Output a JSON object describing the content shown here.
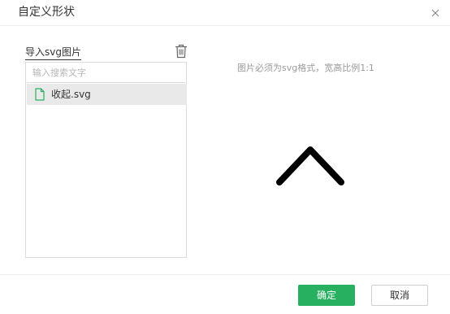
{
  "dialog": {
    "title": "自定义形状"
  },
  "left_panel": {
    "import_label": "导入svg图片",
    "search_placeholder": "输入搜索文字",
    "items": [
      {
        "label": "收起.svg",
        "selected": true
      }
    ]
  },
  "preview": {
    "hint": "图片必须为svg格式，宽高比例1:1",
    "shape_icon": "chevron-up-icon"
  },
  "footer": {
    "ok_label": "确定",
    "cancel_label": "取消"
  },
  "colors": {
    "accent": "#27b060",
    "file_icon": "#27b060",
    "selected_bg": "#e9e9e9"
  }
}
